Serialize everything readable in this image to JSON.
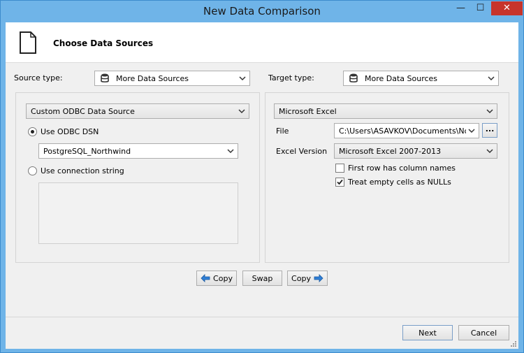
{
  "window": {
    "title": "New Data Comparison",
    "minimize_glyph": "—",
    "maximize_glyph": "☐",
    "close_glyph": "✕"
  },
  "header": {
    "title": "Choose Data Sources",
    "icon": "document-icon"
  },
  "source": {
    "type_label": "Source type:",
    "type_value": "More Data Sources",
    "provider_value": "Custom ODBC Data Source",
    "use_dsn_label": "Use ODBC DSN",
    "use_dsn_selected": true,
    "dsn_value": "PostgreSQL_Northwind",
    "use_connstr_label": "Use connection string",
    "use_connstr_selected": false,
    "connection_string": ""
  },
  "target": {
    "type_label": "Target type:",
    "type_value": "More Data Sources",
    "provider_value": "Microsoft Excel",
    "file_label": "File",
    "file_value": "C:\\Users\\ASAVKOV\\Documents\\Northw",
    "browse_label": "...",
    "version_label": "Excel Version",
    "version_value": "Microsoft Excel 2007-2013",
    "first_row_label": "First row has column names",
    "first_row_checked": false,
    "empty_nulls_label": "Treat empty cells as NULLs",
    "empty_nulls_checked": true
  },
  "actions": {
    "copy_left_label": "Copy",
    "swap_label": "Swap",
    "copy_right_label": "Copy"
  },
  "footer": {
    "next_label": "Next",
    "cancel_label": "Cancel"
  },
  "colors": {
    "window_frame": "#6fb4e8",
    "close_button": "#c7342b",
    "arrow_blue": "#2f7fd6"
  }
}
